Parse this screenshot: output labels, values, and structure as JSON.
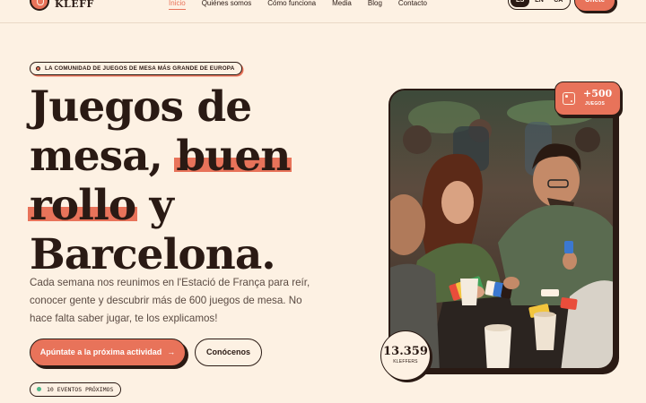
{
  "brand": {
    "name": "KLEFF"
  },
  "nav": {
    "links": [
      "Inicio",
      "Quiénes somos",
      "Cómo funciona",
      "Media",
      "Blog",
      "Contacto"
    ],
    "active": "Inicio",
    "languages": [
      "ES",
      "EN",
      "CA"
    ],
    "selected_language": "ES",
    "join_label": "Únete"
  },
  "hero": {
    "badge": "LA COMUNIDAD DE JUEGOS DE MESA MÁS GRANDE DE EUROPA",
    "headline": {
      "w1": "Juegos de",
      "w2": "mesa,",
      "w3": "buen",
      "w4": "rollo",
      "w5": "y",
      "w6": "Barcelona."
    },
    "description": "Cada semana nos reunimos en l'Estació de França para reír, conocer gente y descubrir más de 600 juegos de mesa. No hace falta saber jugar, te los explicamos!",
    "cta_primary": "Apúntate a la próxima actividad",
    "cta_arrow": "→",
    "cta_secondary": "Conócenos",
    "events_badge": "10 EVENTOS PRÓXIMOS"
  },
  "stats": {
    "games_count": "+500",
    "games_label": "JUEGOS",
    "members_count": "13.359",
    "members_label": "KLEFFERS"
  },
  "colors": {
    "background": "#fdf1e3",
    "accent": "#e8735a",
    "ink": "#2a1a14",
    "success": "#4fb88a"
  },
  "icons": {
    "logo": "kleff-logo-icon",
    "dice": "dice-icon",
    "arrow": "arrow-right-icon"
  }
}
